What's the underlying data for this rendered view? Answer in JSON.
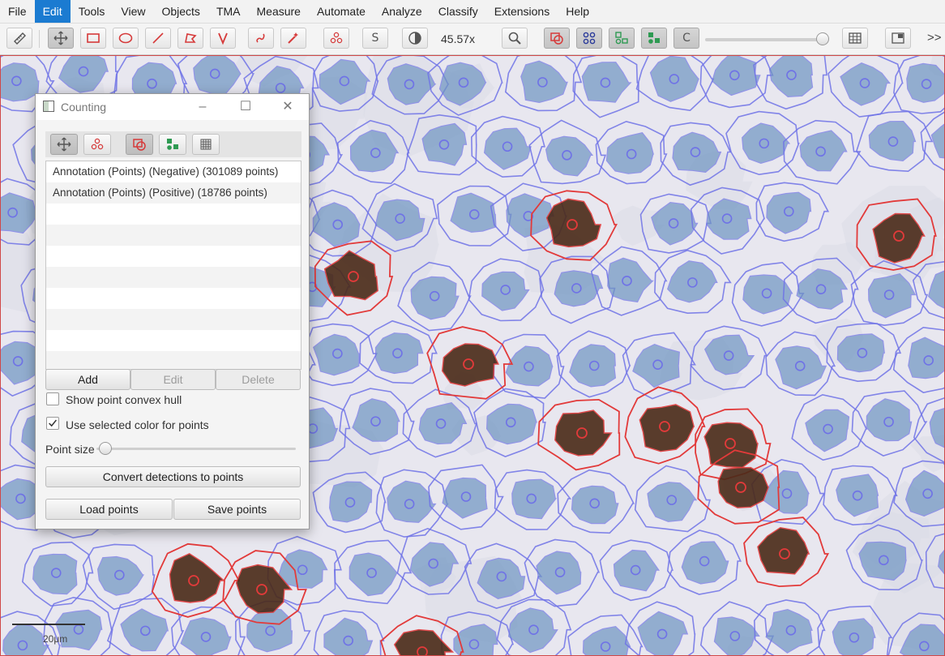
{
  "menu": [
    "File",
    "Edit",
    "Tools",
    "View",
    "Objects",
    "TMA",
    "Measure",
    "Automate",
    "Analyze",
    "Classify",
    "Extensions",
    "Help"
  ],
  "menu_active": "Edit",
  "toolbar": {
    "zoom": "45.57x",
    "show_names_glyph": "S",
    "c_glyph": "C",
    "overflow_glyph": ">>"
  },
  "viewer": {
    "scale_label": "20μm"
  },
  "counting": {
    "title": "Counting",
    "annotations": [
      "Annotation (Points) (Negative) (301089 points)",
      "Annotation (Points) (Positive) (18786 points)"
    ],
    "add_label": "Add",
    "edit_label": "Edit",
    "delete_label": "Delete",
    "show_hull_label": "Show point convex hull",
    "show_hull_checked": false,
    "use_color_label": "Use selected color for points",
    "use_color_checked": true,
    "point_size_label": "Point size",
    "convert_label": "Convert detections to points",
    "load_label": "Load points",
    "save_label": "Save points"
  },
  "colors": {
    "menu_active": "#1b7bd1",
    "negative_outline": "#6f72e6",
    "positive_outline": "#e23a3a",
    "nucleus_blue": "#6f95c2",
    "nucleus_brown": "#4a2a18"
  }
}
